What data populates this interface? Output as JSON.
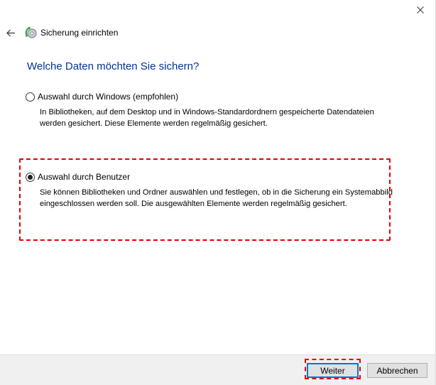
{
  "header": {
    "title": "Sicherung einrichten",
    "back_icon": "back-arrow-icon",
    "app_icon": "backup-icon",
    "close_icon": "close-icon"
  },
  "main": {
    "heading": "Welche Daten möchten Sie sichern?",
    "options": [
      {
        "label": "Auswahl durch Windows (empfohlen)",
        "description": "In Bibliotheken, auf dem Desktop und in Windows-Standardordnern gespeicherte Datendateien werden gesichert. Diese Elemente werden regelmäßig gesichert.",
        "selected": false
      },
      {
        "label": "Auswahl durch Benutzer",
        "description": "Sie können Bibliotheken und Ordner auswählen und festlegen, ob in die Sicherung ein Systemabbild eingeschlossen werden soll. Die ausgewählten Elemente werden regelmäßig gesichert.",
        "selected": true
      }
    ]
  },
  "footer": {
    "next_label": "Weiter",
    "cancel_label": "Abbrechen"
  },
  "colors": {
    "heading": "#003399",
    "highlight": "#e00000",
    "footer_bg": "#f0f0f0",
    "focus_border": "#0078d7"
  }
}
